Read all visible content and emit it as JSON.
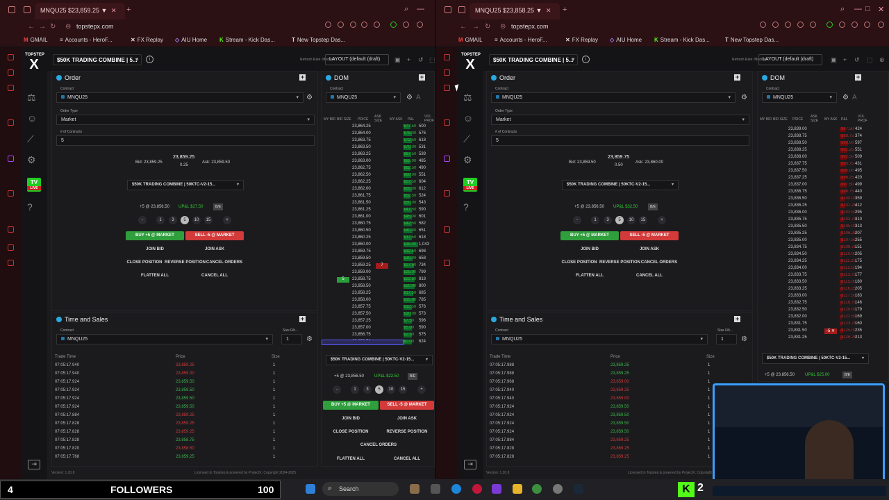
{
  "tabs": {
    "left": "MNQU25 $23,859.25 ▼",
    "right": "MNQU25 $23,858.25 ▼"
  },
  "url": "topstepx.com",
  "bookmarks": [
    {
      "icon": "G",
      "label": "GMAIL"
    },
    {
      "icon": "≡",
      "label": "Accounts - HeroF..."
    },
    {
      "icon": "✕",
      "label": "FX Replay"
    },
    {
      "icon": "◇",
      "label": "AIU Home"
    },
    {
      "icon": "K",
      "label": "Stream - Kick Das..."
    },
    {
      "icon": "T",
      "label": "New Topstep Das..."
    }
  ],
  "brand": {
    "line1": "TOPSTEP",
    "mark": "X"
  },
  "tv": {
    "label": "TV",
    "sub": "LIVE"
  },
  "account": "$50K TRADING COMBINE | 5...",
  "refresh_rate": "Refresh Rate: Medium",
  "layout": "LAYOUT (default (draft)",
  "order": {
    "title": "Order",
    "contract_label": "Contract",
    "contract": "MNQU25",
    "type_label": "Order Type",
    "type": "Market",
    "qty_label": "# of Contracts",
    "qty": "5",
    "account_select": "$50K TRADING COMBINE | 50KTC-V2-15...",
    "sizes": [
      "-",
      "1",
      "3",
      "5",
      "10",
      "15",
      "+"
    ],
    "be": "B/E",
    "join_bid": "JOIN BID",
    "join_ask": "JOIN ASK",
    "close_position": "CLOSE POSITION",
    "reverse_position": "REVERSE POSITION",
    "cancel_orders": "CANCEL ORDERS",
    "flatten_all": "FLATTEN ALL",
    "cancel_all": "CANCEL ALL"
  },
  "left": {
    "bid": "Bid: 23,859.25",
    "last": "23,859.25",
    "spread": "0.25",
    "ask": "Ask: 23,859.50",
    "position": "+5 @ 23,856.50",
    "upl": "UP&L $27.50",
    "buy": "BUY +5 @ MARKET",
    "sell": "SELL -5 @ MARKET"
  },
  "right": {
    "bid": "Bid: 23,859.50",
    "last": "23,859.75",
    "spread": "0.50",
    "ask": "Ask: 23,860.00",
    "position": "+5 @ 23,856.50",
    "upl": "UP&L $32.50",
    "buy": "BUY +5 @ MARKET",
    "sell": "SELL -5 @ MARKET"
  },
  "dom": {
    "title": "DOM",
    "headers": [
      "MY BID",
      "BID SIZE",
      "PRICE",
      "ASK SIZE",
      "MY ASK",
      "P&L",
      "VOL PROF"
    ],
    "left_rows": [
      [
        "23,864.25",
        "$77.50",
        "500"
      ],
      [
        "23,864.00",
        "$75.00",
        "576"
      ],
      [
        "23,863.75",
        "$72.50",
        "618"
      ],
      [
        "23,863.50",
        "$70.00",
        "531"
      ],
      [
        "23,863.25",
        "$67.50",
        "539"
      ],
      [
        "23,863.00",
        "$65.00",
        "485"
      ],
      [
        "23,862.75",
        "$62.50",
        "490"
      ],
      [
        "23,862.50",
        "$60.00",
        "551"
      ],
      [
        "23,862.25",
        "$57.50",
        "604"
      ],
      [
        "23,862.00",
        "$55.00",
        "612"
      ],
      [
        "23,861.75",
        "$52.50",
        "524"
      ],
      [
        "23,861.50",
        "$50.00",
        "543"
      ],
      [
        "23,861.25",
        "$47.50",
        "590"
      ],
      [
        "23,861.00",
        "$45.00",
        "601"
      ],
      [
        "23,860.75",
        "$42.50",
        "582"
      ],
      [
        "23,860.50",
        "$40.00",
        "651"
      ],
      [
        "23,860.25",
        "$37.50",
        "618"
      ],
      [
        "23,860.00",
        "$35.00",
        "1,043"
      ],
      [
        "23,859.75",
        "$32.50",
        "698"
      ],
      [
        "23,859.50",
        "$30.00",
        "658"
      ],
      [
        "23,859.25",
        "$27.50",
        "734"
      ],
      [
        "23,859.00",
        "$25.00",
        "799"
      ],
      [
        "23,858.75",
        "$22.50",
        "818"
      ],
      [
        "23,858.50",
        "$20.00",
        "800"
      ],
      [
        "23,858.25",
        "$17.50",
        "685"
      ],
      [
        "23,858.00",
        "$15.00",
        "785"
      ],
      [
        "23,857.75",
        "$12.50",
        "576"
      ],
      [
        "23,857.50",
        "$10.00",
        "573"
      ],
      [
        "23,857.25",
        "$7.50",
        "596"
      ],
      [
        "23,857.00",
        "$5.00",
        "590"
      ],
      [
        "23,856.75",
        "$2.50",
        "575"
      ],
      [
        "23,856.50",
        "$0.00",
        "624"
      ]
    ],
    "right_rows": [
      [
        "23,839.00",
        "-$87.50",
        "424"
      ],
      [
        "23,838.75",
        "-$88.75",
        "374"
      ],
      [
        "23,838.50",
        "-$90.00",
        "597"
      ],
      [
        "23,838.25",
        "-$91.25",
        "551"
      ],
      [
        "23,838.00",
        "-$92.50",
        "509"
      ],
      [
        "23,837.75",
        "-$93.75",
        "431"
      ],
      [
        "23,837.50",
        "-$95.00",
        "495"
      ],
      [
        "23,837.25",
        "-$96.25",
        "420"
      ],
      [
        "23,837.00",
        "-$97.50",
        "499"
      ],
      [
        "23,836.75",
        "-$98.75",
        "440"
      ],
      [
        "23,836.50",
        "-$100.00",
        "359"
      ],
      [
        "23,836.25",
        "-$101.25",
        "412"
      ],
      [
        "23,836.00",
        "-$102.50",
        "295"
      ],
      [
        "23,835.75",
        "-$103.75",
        "310"
      ],
      [
        "23,835.50",
        "-$105.00",
        "313"
      ],
      [
        "23,835.25",
        "-$106.25",
        "207"
      ],
      [
        "23,835.00",
        "-$107.50",
        "255"
      ],
      [
        "23,834.75",
        "-$108.75",
        "151"
      ],
      [
        "23,834.50",
        "-$110.00",
        "205"
      ],
      [
        "23,834.25",
        "-$111.25",
        "175"
      ],
      [
        "23,834.00",
        "-$112.50",
        "194"
      ],
      [
        "23,833.75",
        "-$113.75",
        "177"
      ],
      [
        "23,833.50",
        "-$115.00",
        "180"
      ],
      [
        "23,833.25",
        "-$116.25",
        "205"
      ],
      [
        "23,833.00",
        "-$117.50",
        "183"
      ],
      [
        "23,832.75",
        "-$118.75",
        "146"
      ],
      [
        "23,832.50",
        "-$120.00",
        "179"
      ],
      [
        "23,832.00",
        "-$122.50",
        "169"
      ],
      [
        "23,831.75",
        "-$123.75",
        "160"
      ],
      [
        "23,831.50",
        "-$125.00",
        "235"
      ],
      [
        "23,831.25",
        "-$126.25",
        "213"
      ]
    ],
    "left_ask_marker": "7",
    "left_bid_marker": "5",
    "right_sell_marker": "-5"
  },
  "tas": {
    "title": "Time and Sales",
    "contract": "MNQU25",
    "size_filter_label": "Size Filt...",
    "size_filter": "1",
    "headers": {
      "time": "Trade Time",
      "price": "Price",
      "size": "Size"
    },
    "left_rows": [
      [
        "07:05:17.940",
        "23,859.25",
        "r"
      ],
      [
        "07:05:17.940",
        "23,859.00",
        "r"
      ],
      [
        "07:05:17.924",
        "23,859.50",
        "g"
      ],
      [
        "07:05:17.924",
        "23,859.50",
        "g"
      ],
      [
        "07:05:17.924",
        "23,859.50",
        "g"
      ],
      [
        "07:05:17.924",
        "23,859.50",
        "g"
      ],
      [
        "07:05:17.884",
        "23,859.25",
        "r"
      ],
      [
        "07:05:17.828",
        "23,859.25",
        "r"
      ],
      [
        "07:05:17.828",
        "23,859.25",
        "r"
      ],
      [
        "07:05:17.828",
        "23,858.75",
        "g"
      ],
      [
        "07:05:17.820",
        "23,858.50",
        "r"
      ],
      [
        "07:05:17.768",
        "23,859.25",
        "g"
      ]
    ],
    "right_rows": [
      [
        "07:05:17.988",
        "23,859.25",
        "g"
      ],
      [
        "07:05:17.988",
        "23,859.25",
        "g"
      ],
      [
        "07:05:17.968",
        "23,859.00",
        "r"
      ],
      [
        "07:05:17.940",
        "23,859.25",
        "r"
      ],
      [
        "07:05:17.940",
        "23,859.00",
        "r"
      ],
      [
        "07:05:17.924",
        "23,859.50",
        "g"
      ],
      [
        "07:05:17.924",
        "23,859.50",
        "g"
      ],
      [
        "07:05:17.924",
        "23,859.50",
        "g"
      ],
      [
        "07:05:17.924",
        "23,859.50",
        "g"
      ],
      [
        "07:05:17.884",
        "23,859.25",
        "r"
      ],
      [
        "07:05:17.828",
        "23,859.25",
        "r"
      ],
      [
        "07:05:17.828",
        "23,859.25",
        "r"
      ]
    ],
    "size": "1"
  },
  "footer": {
    "version": "Version: 1.20.8",
    "license": "Licensed to Topstep & powered by ProjectX. Copyright 2024-2025"
  },
  "stream": {
    "count": "4",
    "label": "FOLLOWERS",
    "goal": "100",
    "kick_count": "2"
  },
  "taskbar": {
    "search": "Search"
  },
  "colors": {
    "buy": "#2f9e3c",
    "sell": "#d33a3a",
    "accent": "#2aa9e0",
    "kick": "#53fc18"
  }
}
